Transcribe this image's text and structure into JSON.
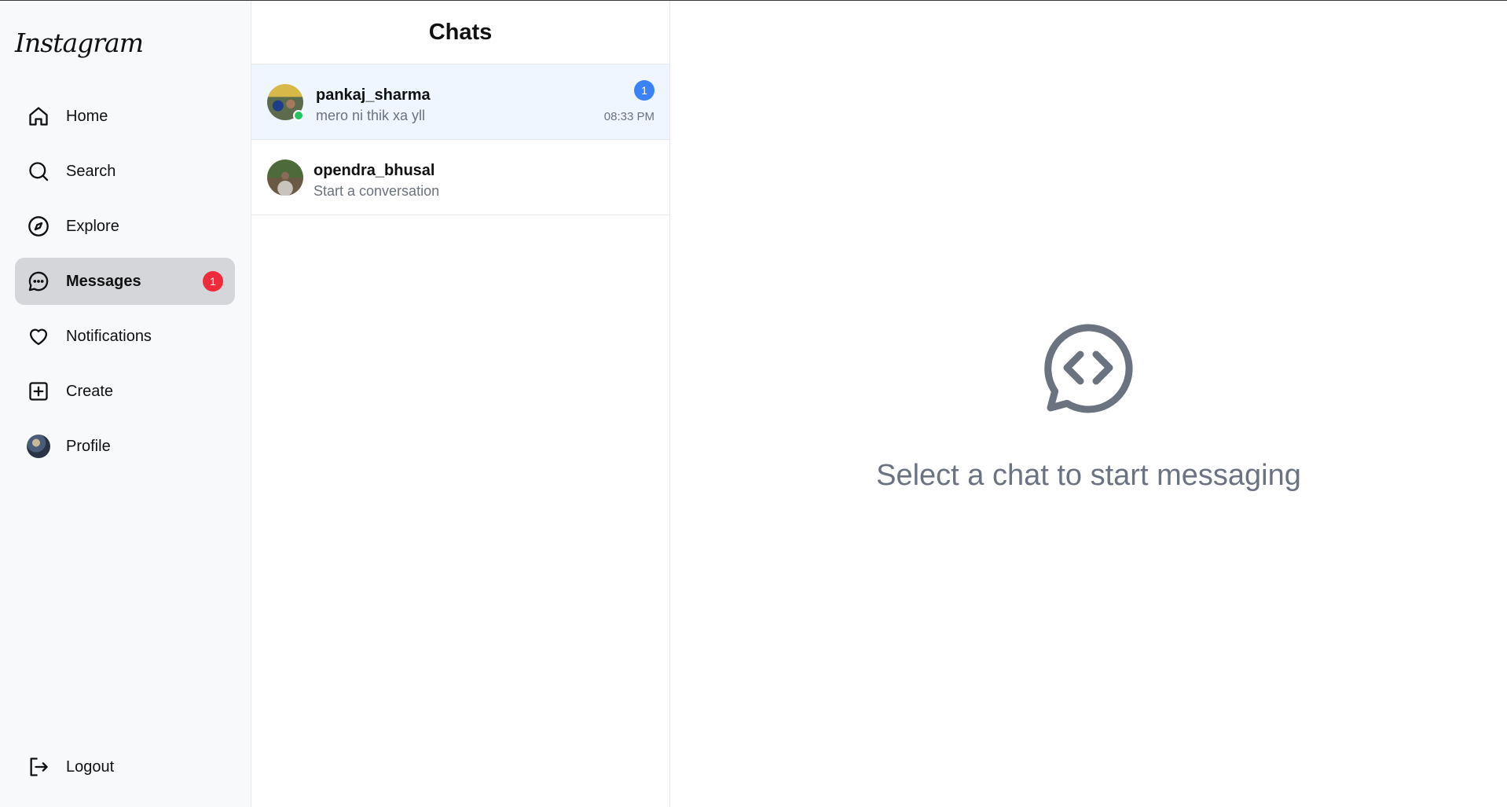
{
  "app": {
    "logo_text": "Instagram"
  },
  "sidebar": {
    "items": [
      {
        "label": "Home",
        "icon": "home-icon"
      },
      {
        "label": "Search",
        "icon": "search-icon"
      },
      {
        "label": "Explore",
        "icon": "compass-icon"
      },
      {
        "label": "Messages",
        "icon": "message-icon",
        "active": true,
        "badge": "1"
      },
      {
        "label": "Notifications",
        "icon": "heart-icon"
      },
      {
        "label": "Create",
        "icon": "plus-square-icon"
      },
      {
        "label": "Profile",
        "icon": "avatar"
      }
    ],
    "logout_label": "Logout",
    "logout_icon": "logout-icon"
  },
  "chats": {
    "title": "Chats",
    "items": [
      {
        "name": "pankaj_sharma",
        "preview": "mero ni thik xa yll",
        "time": "08:33 PM",
        "unread": "1",
        "online": true,
        "selected": true
      },
      {
        "name": "opendra_bhusal",
        "preview": "Start a conversation"
      }
    ]
  },
  "main": {
    "empty_icon": "chat-bubble-code-icon",
    "empty_text": "Select a chat to start messaging"
  },
  "colors": {
    "accent_blue": "#3b82f6",
    "badge_red": "#ef2a3b",
    "online_green": "#22c55e",
    "selected_row": "#eff6ff",
    "active_nav": "#d4d6da",
    "muted_text": "#6b7280"
  }
}
